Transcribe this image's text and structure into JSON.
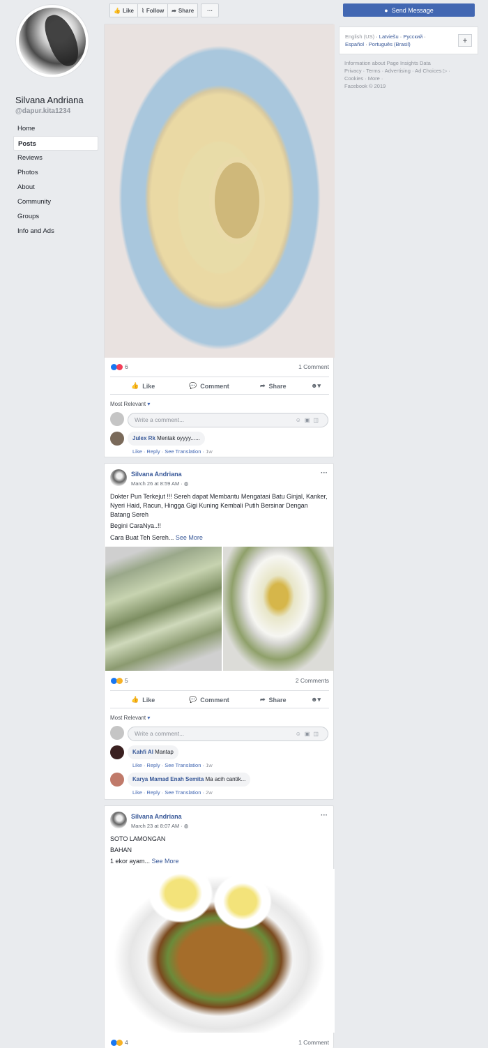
{
  "page": {
    "name": "Silvana Andriana",
    "handle": "@dapur.kita1234"
  },
  "nav": [
    "Home",
    "Posts",
    "Reviews",
    "Photos",
    "About",
    "Community",
    "Groups",
    "Info and Ads"
  ],
  "nav_active_index": 1,
  "toolbar": {
    "like": "Like",
    "follow": "Follow",
    "share": "Share",
    "more": "···"
  },
  "send_message": "Send Message",
  "languages": {
    "current": "English (US)",
    "others": [
      "Latviešu",
      "Русский",
      "Español",
      "Português (Brasil)"
    ],
    "add": "+"
  },
  "footer": {
    "line1": "Information about Page Insights Data",
    "line2": "Privacy · Terms · Advertising · Ad Choices ▷ ·",
    "line3": "Cookies · More ·",
    "line4": "Facebook © 2019"
  },
  "common": {
    "like": "Like",
    "comment": "Comment",
    "share": "Share",
    "most_relevant": "Most Relevant",
    "write_comment": "Write a comment...",
    "comment_actions": "Like · Reply · See Translation ·"
  },
  "post1": {
    "reactions": "6",
    "comments": "1 Comment",
    "comment": {
      "author": "Julex Rk",
      "text": "Mentak oyyyy......",
      "time": "1w"
    }
  },
  "post2": {
    "author": "Silvana Andriana",
    "date": "March 26 at 8:59 AM · ",
    "text1": "Dokter Pun Terkejut !!! Sereh dapat Membantu Mengatasi Batu Ginjal, Kanker, Nyeri Haid, Racun, Hingga Gigi Kuning Kembali Putih Bersinar Dengan Batang Sereh",
    "text2": "Begini CaraNya..!!",
    "text3": "Cara Buat Teh Sereh...",
    "see_more": "See More",
    "reactions": "5",
    "comments": "2 Comments",
    "comments_list": [
      {
        "author": "Kahfi Al",
        "text": "Mantap",
        "time": "1w"
      },
      {
        "author": "Karya Mamad Enah Semita",
        "text": "Ma acih cantik...",
        "time": "2w"
      }
    ]
  },
  "post3": {
    "author": "Silvana Andriana",
    "date": "March 23 at 8:07 AM · ",
    "text1": "SOTO LAMONGAN",
    "text2": "BAHAN",
    "text3": "1 ekor ayam...",
    "see_more": "See More",
    "reactions": "4",
    "comments": "1 Comment"
  }
}
